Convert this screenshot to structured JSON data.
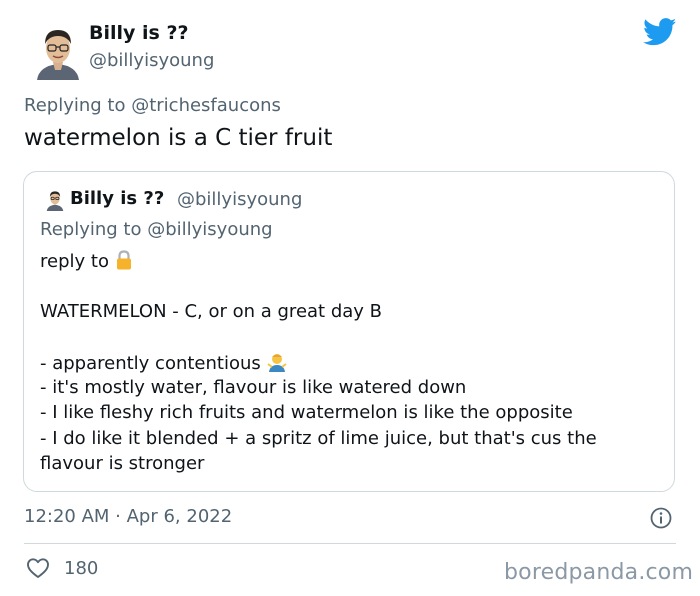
{
  "tweet": {
    "display_name": "Billy is ??",
    "handle": "@billyisyoung",
    "replying_to_prefix": "Replying to",
    "replying_to_mention": "@trichesfaucons",
    "text": "watermelon is a C tier fruit",
    "timestamp": "12:20 AM · Apr 6, 2022",
    "like_count": "180"
  },
  "quoted": {
    "display_name": "Billy is ??",
    "handle": "@billyisyoung",
    "replying_to_prefix": "Replying to",
    "replying_to_mention": "@billyisyoung",
    "lines": [
      "reply to",
      "WATERMELON - C, or on a great day B",
      "- apparently contentious",
      "- it's mostly water, flavour is like watered down",
      "- I like fleshy rich fruits and watermelon is like the opposite",
      "- I do like it blended + a spritz of lime juice, but that's cus the",
      "flavour is stronger"
    ]
  },
  "icons": {
    "brand": "twitter-bird-icon",
    "lock": "lock-emoji-icon",
    "person": "person-shrugging-emoji-icon",
    "info": "info-icon",
    "like": "heart-icon"
  },
  "colors": {
    "twitter_blue": "#1d9bf0",
    "secondary_text": "#536471",
    "border": "#cfd9de"
  },
  "watermark": "boredpanda.com"
}
